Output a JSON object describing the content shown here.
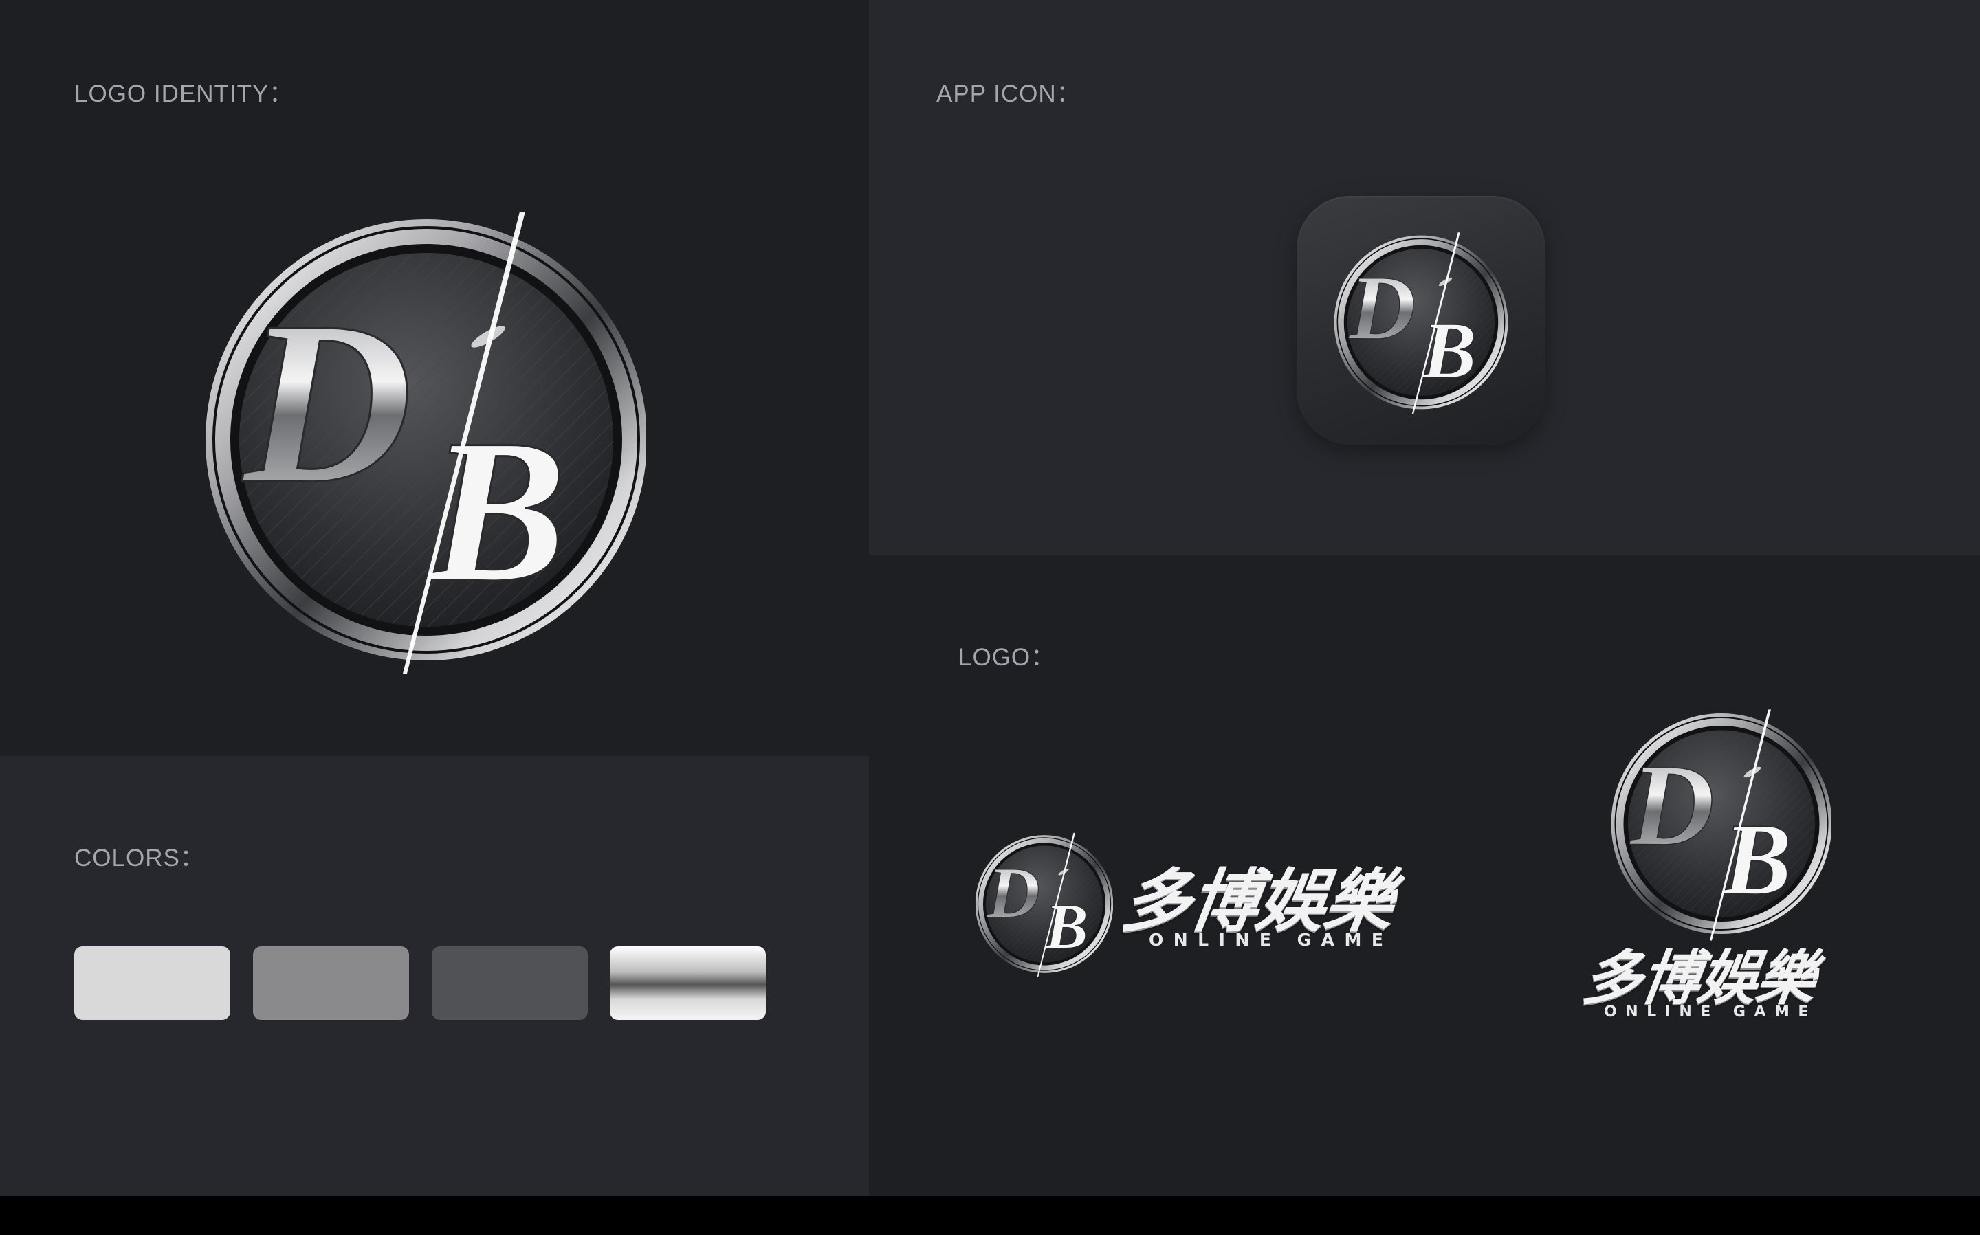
{
  "sections": {
    "logo_identity": {
      "label": "LOGO IDENTITY："
    },
    "app_icon": {
      "label": "APP ICON："
    },
    "colors": {
      "label": "COLORS："
    },
    "logo": {
      "label": "LOGO："
    }
  },
  "emblem": {
    "letters": [
      "D",
      "B"
    ]
  },
  "brand": {
    "chinese_name": "多博娛樂",
    "subtitle": "ONLINE GAME"
  },
  "colors": {
    "panel_dark": "#1e1f23",
    "panel_light": "#27282d",
    "swatches": [
      {
        "type": "solid",
        "value": "#d9d9d9"
      },
      {
        "type": "solid",
        "value": "#8a8a8d"
      },
      {
        "type": "solid",
        "value": "#515256"
      },
      {
        "type": "gradient",
        "stops": [
          "#ffffff",
          "#bdbdbd",
          "#555555",
          "#d9d9d9",
          "#f5f5f5"
        ]
      }
    ]
  }
}
